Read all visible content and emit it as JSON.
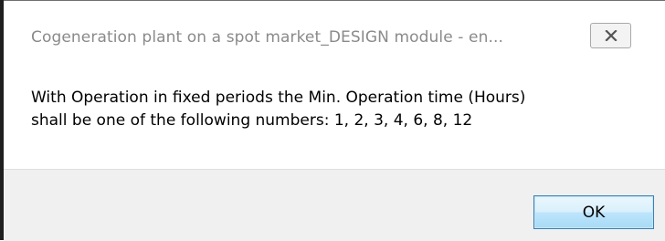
{
  "dialog": {
    "title": "Cogeneration plant on a spot market_DESIGN module - en...",
    "close_icon": "close-icon",
    "message_line1": "With Operation in fixed periods the Min. Operation time (Hours)",
    "message_line2": "shall be one of the following numbers: 1, 2, 3, 4, 6, 8, 12",
    "ok_label": "OK"
  }
}
